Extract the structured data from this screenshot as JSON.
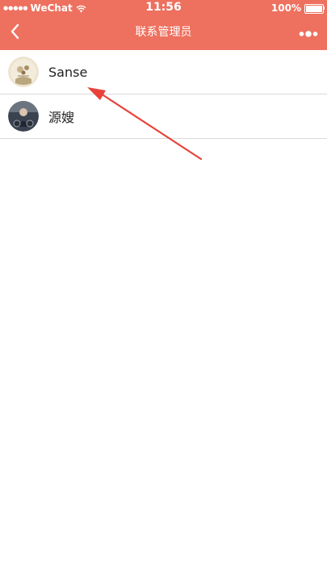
{
  "status_bar": {
    "signal": "●●●●●",
    "carrier": "WeChat",
    "time": "11:56",
    "battery": "100%"
  },
  "nav": {
    "title": "联系管理员",
    "back_icon": "chevron-left-icon",
    "more_icon": "more-dots-icon"
  },
  "contacts": [
    {
      "name": "Sanse",
      "avatar": "avatar-sanse"
    },
    {
      "name": "源嫂",
      "avatar": "avatar-yuansao"
    }
  ],
  "colors": {
    "header_bg": "#ee705e",
    "annotation": "#e8423a",
    "divider": "#d9d9d9"
  }
}
